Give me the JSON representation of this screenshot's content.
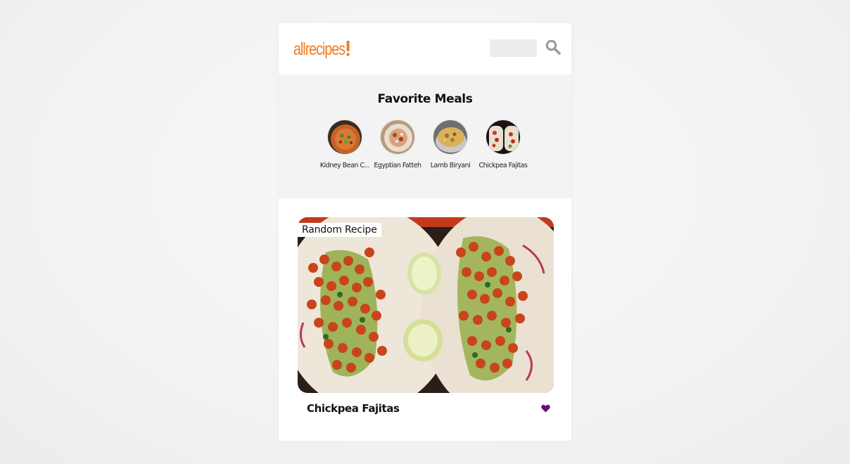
{
  "header": {
    "logo_text": "allrecipes",
    "search_placeholder": "",
    "search_icon": "search-icon"
  },
  "favorites": {
    "title": "Favorite Meals",
    "items": [
      {
        "label": "Kidney Bean C..."
      },
      {
        "label": "Egyptian Fatteh"
      },
      {
        "label": "Lamb Biryani"
      },
      {
        "label": "Chickpea Fajitas"
      }
    ]
  },
  "random_recipe": {
    "tag": "Random Recipe",
    "name": "Chickpea Fajitas",
    "favorite_icon": "heart-icon"
  },
  "colors": {
    "brand": "#f27b21",
    "heart": "#6a0f7a",
    "panel_bg": "#f3f3f3"
  }
}
